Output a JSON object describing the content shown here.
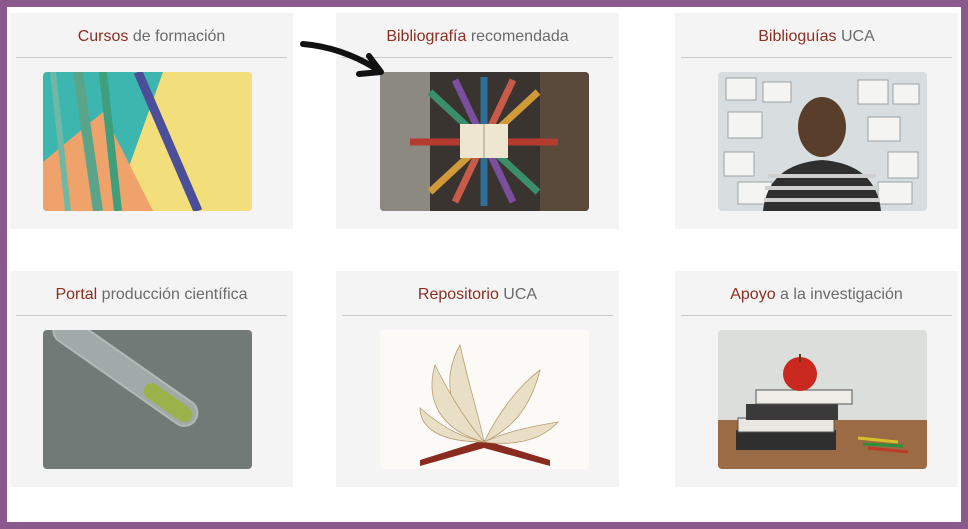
{
  "cards": [
    {
      "highlight": "Cursos",
      "rest": " de formación",
      "icon": "markers-image"
    },
    {
      "highlight": "Bibliografía",
      "rest": " recomendada",
      "icon": "book-sculpture-image"
    },
    {
      "highlight": "Biblioguías",
      "rest": " UCA",
      "icon": "person-wall-image"
    },
    {
      "highlight": "Portal",
      "rest": " producción científica",
      "icon": "test-tube-image"
    },
    {
      "highlight": "Repositorio",
      "rest": " UCA",
      "icon": "open-book-image"
    },
    {
      "highlight": "Apoyo",
      "rest": " a la investigación",
      "icon": "apple-books-image"
    }
  ],
  "colors": {
    "accent": "#8b2f23",
    "border": "#8a5a8c",
    "card_bg": "#f4f4f4",
    "text": "#6b6b6b"
  }
}
